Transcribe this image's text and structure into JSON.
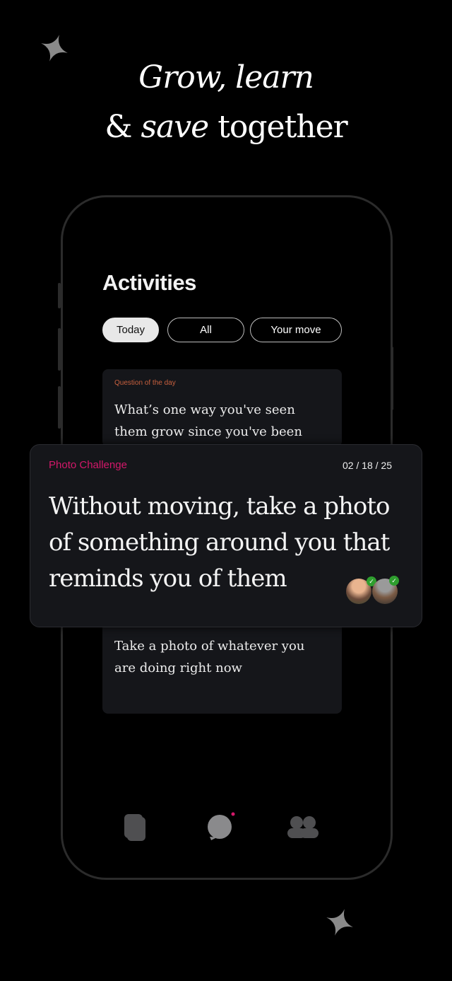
{
  "headline": {
    "line1": "Grow, learn",
    "line2_prefix": "& ",
    "line2_italic": "save",
    "line2_suffix": " together"
  },
  "screen": {
    "title": "Activities",
    "filters": [
      {
        "label": "Today",
        "active": true
      },
      {
        "label": "All",
        "active": false
      },
      {
        "label": "Your move",
        "active": false
      }
    ],
    "cards": [
      {
        "category": "Question of the day",
        "text": "What’s one way you've seen them grow since you've been"
      },
      {
        "category": "Photo Challenge",
        "date": "02 / 18 / 25",
        "text": "Without moving, take a photo of something around you that reminds you of them",
        "participants": [
          {
            "name": "participant-1",
            "completed": true
          },
          {
            "name": "participant-2",
            "completed": true
          }
        ]
      },
      {
        "text": "Take a photo of whatever you are doing right now"
      }
    ],
    "nav": [
      {
        "icon": "cards-icon"
      },
      {
        "icon": "chat-icon",
        "badge": true
      },
      {
        "icon": "people-icon"
      }
    ]
  },
  "colors": {
    "accent_pink": "#d4186a",
    "category_orange": "#c8603e",
    "check_green": "#2e9e2e",
    "card_bg": "#15161a"
  }
}
